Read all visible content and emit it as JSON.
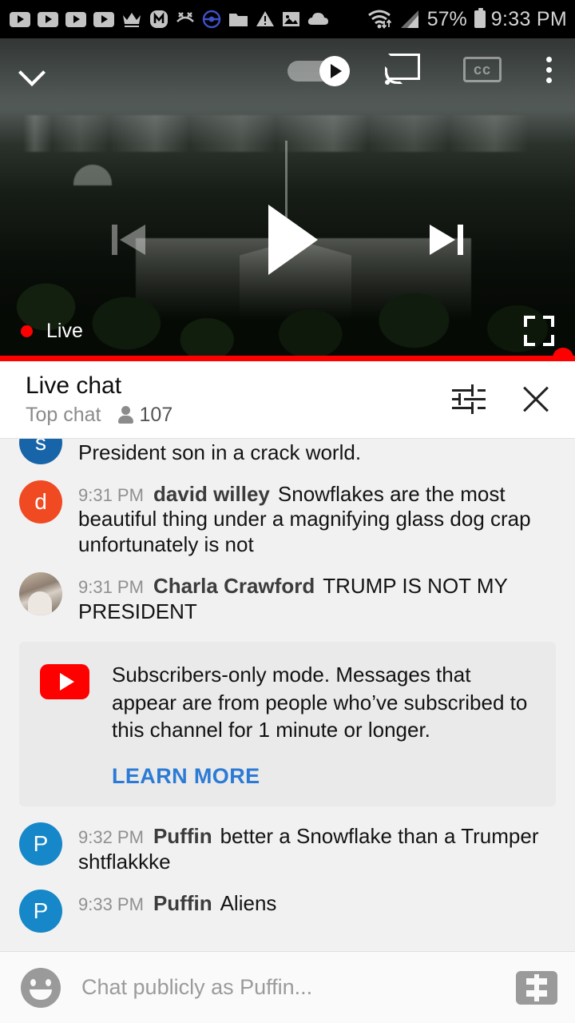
{
  "status_bar": {
    "icons": [
      {
        "name": "youtube-notification-icon-1",
        "glyph": "yt"
      },
      {
        "name": "youtube-notification-icon-2",
        "glyph": "yt"
      },
      {
        "name": "youtube-notification-icon-3",
        "glyph": "yt"
      },
      {
        "name": "youtube-notification-icon-4",
        "glyph": "yt"
      },
      {
        "name": "crown-icon",
        "glyph": "♕"
      },
      {
        "name": "messenger-m-icon",
        "glyph": "Ⓜ"
      },
      {
        "name": "missed-call-icon",
        "glyph": "↘"
      },
      {
        "name": "pokeball-icon",
        "glyph": "◉"
      },
      {
        "name": "folder-icon",
        "glyph": "▰"
      },
      {
        "name": "warning-triangle-icon",
        "glyph": "⚠"
      },
      {
        "name": "image-icon",
        "glyph": "▣"
      },
      {
        "name": "cloud-icon",
        "glyph": "☁"
      }
    ],
    "wifi_icon": "wifi-icon",
    "signal_icon": "cellular-signal-icon",
    "battery_percent": "57%",
    "battery_icon": "battery-icon",
    "clock": "9:33 PM"
  },
  "player": {
    "collapse_icon": "chevron-down-icon",
    "autoplay_toggle": {
      "name": "autoplay-toggle",
      "state": "on"
    },
    "cast_icon": "cast-icon",
    "captions_label": "cc",
    "more_options_icon": "kebab-menu-icon",
    "previous_icon": "previous-track-icon",
    "play_icon": "play-icon",
    "next_icon": "next-track-icon",
    "live_label": "Live",
    "live_dot_color": "#ff0000",
    "fullscreen_icon": "fullscreen-icon",
    "progress_percent": 100,
    "progress_color": "#ff0000"
  },
  "chat_header": {
    "title": "Live chat",
    "mode": "Top chat",
    "viewer_icon": "person-icon",
    "viewer_count": "107",
    "settings_icon": "tune-icon",
    "close_icon": "close-icon"
  },
  "messages": [
    {
      "avatar_letter": "s",
      "avatar_color": "#1864a8",
      "time": "",
      "author": "",
      "text": "President son in a crack world.",
      "partial": true
    },
    {
      "avatar_letter": "d",
      "avatar_color": "#f04a23",
      "time": "9:31 PM",
      "author": "david willey",
      "text": "Snowflakes are the most beautiful thing under a magnifying glass dog crap unfortunately is not",
      "partial": false
    },
    {
      "avatar_letter": "",
      "avatar_color": "",
      "avatar_type": "photo",
      "time": "9:31 PM",
      "author": "Charla Crawford",
      "text": "TRUMP IS NOT MY PRESIDENT",
      "partial": false
    }
  ],
  "notice": {
    "logo": "youtube-logo-icon",
    "text": "Subscribers-only mode. Messages that appear are from people who’ve subscribed to this channel for 1 minute or longer.",
    "link_label": "LEARN MORE",
    "link_color": "#2b7bd6"
  },
  "messages_after": [
    {
      "avatar_letter": "P",
      "avatar_color": "#1687c8",
      "time": "9:32 PM",
      "author": "Puffin",
      "text": "better a Snowflake than a Trumper shtflakkke"
    },
    {
      "avatar_letter": "P",
      "avatar_color": "#1687c8",
      "time": "9:33 PM",
      "author": "Puffin",
      "text": "Aliens"
    }
  ],
  "chat_input": {
    "emoji_icon": "emoji-icon",
    "placeholder": "Chat publicly as Puffin...",
    "superchat_icon": "super-chat-dollar-icon"
  }
}
